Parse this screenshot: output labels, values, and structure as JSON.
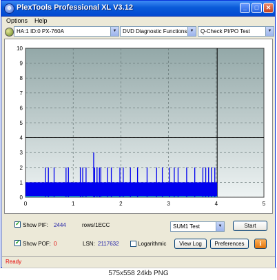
{
  "window": {
    "title": "PlexTools Professional XL V3.12",
    "min_glyph": "_",
    "max_glyph": "□",
    "close_glyph": "✕"
  },
  "menu": [
    "Options",
    "Help"
  ],
  "toolbar": {
    "drive": "HA:1 ID:0  PX-760A",
    "function": "DVD Diagnostic Functions",
    "test": "Q-Check PI/PO Test"
  },
  "chart_data": {
    "type": "bar",
    "x_ticks": [
      "0",
      "1",
      "2",
      "3",
      "4",
      "5"
    ],
    "y_ticks": [
      "0",
      "1",
      "2",
      "3",
      "4",
      "5",
      "6",
      "7",
      "8",
      "9",
      "10"
    ],
    "xlim": [
      0,
      5
    ],
    "ylim": [
      0,
      10
    ],
    "end_marker_x": 4.02,
    "threshold_y": 4,
    "bar_color": "#0000ee",
    "background_top_color": "#93a8a8",
    "background_bottom_color": "#eef3f3",
    "grid": true,
    "series": [
      {
        "baseline_value": 1,
        "baseline_range": [
          0,
          4.02
        ],
        "peaks": [
          {
            "x": 0.42,
            "y": 2
          },
          {
            "x": 0.48,
            "y": 2
          },
          {
            "x": 0.6,
            "y": 2
          },
          {
            "x": 0.85,
            "y": 2
          },
          {
            "x": 0.9,
            "y": 2
          },
          {
            "x": 1.15,
            "y": 2
          },
          {
            "x": 1.2,
            "y": 2
          },
          {
            "x": 1.27,
            "y": 2
          },
          {
            "x": 1.45,
            "y": 2
          },
          {
            "x": 1.5,
            "y": 2
          },
          {
            "x": 1.55,
            "y": 2
          },
          {
            "x": 1.58,
            "y": 2
          },
          {
            "x": 1.72,
            "y": 2
          },
          {
            "x": 1.8,
            "y": 2
          },
          {
            "x": 1.98,
            "y": 2
          },
          {
            "x": 2.05,
            "y": 2
          },
          {
            "x": 2.2,
            "y": 2
          },
          {
            "x": 2.35,
            "y": 2
          },
          {
            "x": 2.55,
            "y": 2
          },
          {
            "x": 2.75,
            "y": 2
          },
          {
            "x": 2.87,
            "y": 2
          },
          {
            "x": 3.02,
            "y": 2
          },
          {
            "x": 3.12,
            "y": 2
          },
          {
            "x": 3.2,
            "y": 2
          },
          {
            "x": 3.38,
            "y": 2
          },
          {
            "x": 3.55,
            "y": 2
          },
          {
            "x": 3.72,
            "y": 2
          },
          {
            "x": 3.78,
            "y": 2
          },
          {
            "x": 3.84,
            "y": 2
          },
          {
            "x": 3.9,
            "y": 2
          },
          {
            "x": 3.97,
            "y": 2
          },
          {
            "x": 1.43,
            "y": 3
          }
        ]
      }
    ]
  },
  "controls": {
    "show_pif_label": "Show PIF:",
    "pif_value": "2444",
    "rows_label": "rows/1ECC",
    "show_pof_label": "Show POF:",
    "pof_value": "0",
    "lsn_label": "LSN:",
    "lsn_value": "2117632",
    "logarithmic_label": "Logarithmic",
    "sum_select": "SUM1 Test",
    "start_label": "Start",
    "view_log_label": "View Log",
    "preferences_label": "Preferences",
    "info_glyph": "i"
  },
  "status": {
    "text": "Ready"
  },
  "caption": "575x558  24kb  PNG"
}
